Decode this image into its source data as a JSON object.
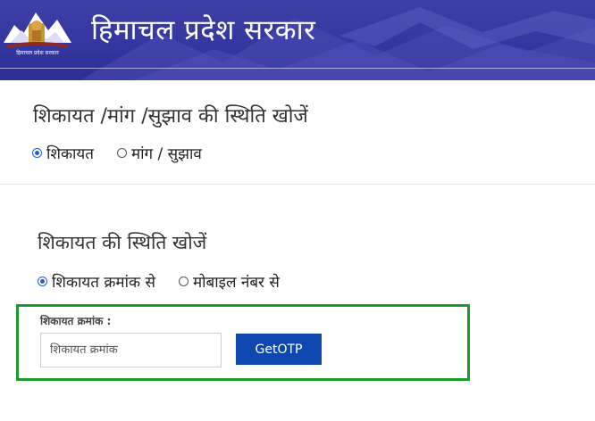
{
  "header": {
    "title": "हिमाचल प्रदेश सरकार",
    "logo_text": "हिमाचल प्रदेश सरकार"
  },
  "section1": {
    "title": "शिकायत /मांग /सुझाव की स्थिति खोजें",
    "options": [
      {
        "label": "शिकायत",
        "selected": true
      },
      {
        "label": "मांग / सुझाव",
        "selected": false
      }
    ]
  },
  "section2": {
    "title": "शिकायत की स्थिति खोजें",
    "options": [
      {
        "label": "शिकायत क्रमांक से",
        "selected": true
      },
      {
        "label": "मोबाइल नंबर से",
        "selected": false
      }
    ],
    "field_label": "शिकायत क्रमांक :",
    "field_placeholder": "शिकायत क्रमांक",
    "field_value": "",
    "button_label": "GetOTP"
  },
  "colors": {
    "header_bg": "#3437a0",
    "accent_button": "#0e47b0",
    "highlight_border": "#1e9a2c",
    "radio_selected": "#1d5fd6"
  }
}
